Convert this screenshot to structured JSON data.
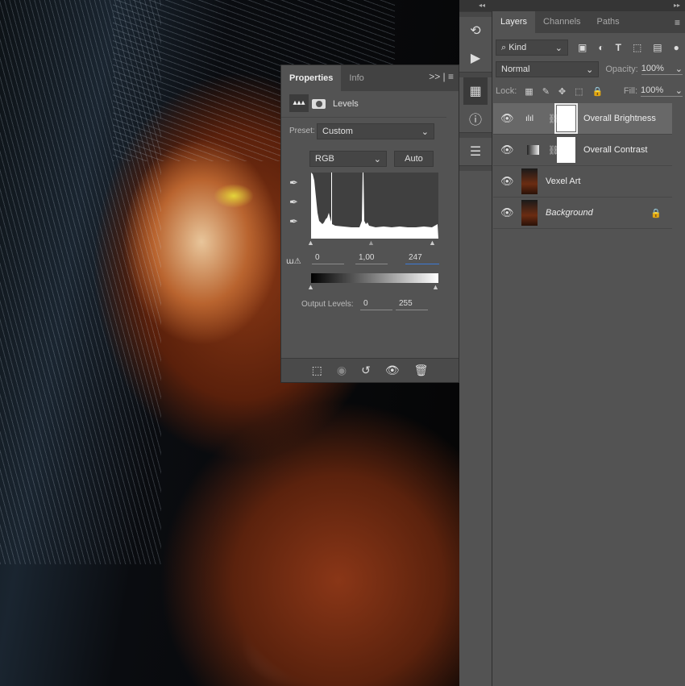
{
  "properties": {
    "tabs": [
      "Properties",
      "Info"
    ],
    "adjustment_title": "Levels",
    "preset_label": "Preset:",
    "preset_value": "Custom",
    "channel_value": "RGB",
    "auto_label": "Auto",
    "input_black": "0",
    "input_gamma": "1,00",
    "input_white": "247",
    "output_label": "Output Levels:",
    "output_black": "0",
    "output_white": "255"
  },
  "layers_panel": {
    "tabs": [
      "Layers",
      "Channels",
      "Paths"
    ],
    "filter_kind": "Kind",
    "blend_mode": "Normal",
    "opacity_label": "Opacity:",
    "opacity_value": "100%",
    "lock_label": "Lock:",
    "fill_label": "Fill:",
    "fill_value": "100%",
    "layers": [
      {
        "name": "Overall Brightness",
        "selected": true
      },
      {
        "name": "Overall Contrast"
      },
      {
        "name": "Vexel Art"
      },
      {
        "name": "Background",
        "locked": true
      }
    ]
  }
}
